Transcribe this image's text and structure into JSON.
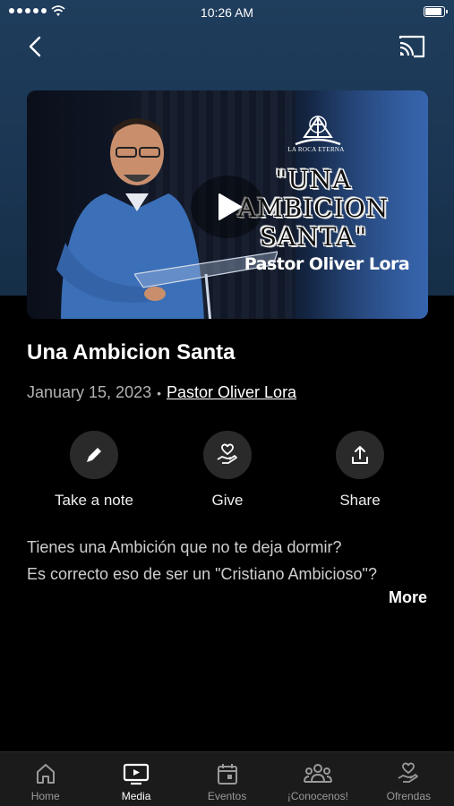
{
  "status_bar": {
    "time": "10:26 AM",
    "battery_level": 0.95
  },
  "nav": {
    "back_icon": "chevron-left-icon",
    "cast_icon": "cast-icon"
  },
  "video": {
    "logo_text": "LA ROCA ETERNA",
    "title_line1": "\"UNA AMBICION",
    "title_line2": "SANTA\"",
    "speaker_overlay": "Pastor Oliver Lora",
    "play_icon": "play-icon"
  },
  "sermon": {
    "title": "Una Ambicion Santa",
    "date": "January 15, 2023",
    "separator": "•",
    "speaker": "Pastor Oliver Lora"
  },
  "actions": [
    {
      "label": "Take a note",
      "icon": "pencil-icon"
    },
    {
      "label": "Give",
      "icon": "give-heart-hand-icon"
    },
    {
      "label": "Share",
      "icon": "share-upload-icon"
    }
  ],
  "description": {
    "line1": "Tienes una Ambición que no te deja dormir?",
    "line2": "Es correcto eso de ser un \"Cristiano Ambicioso\"?",
    "more_label": "More"
  },
  "tabbar": {
    "active": "Media",
    "tabs": [
      {
        "label": "Home",
        "icon": "home-icon"
      },
      {
        "label": "Media",
        "icon": "media-tv-icon"
      },
      {
        "label": "Eventos",
        "icon": "calendar-icon"
      },
      {
        "label": "¡Conocenos!",
        "icon": "group-people-icon"
      },
      {
        "label": "Ofrendas",
        "icon": "give-heart-hand-icon"
      }
    ]
  },
  "colors": {
    "background": "#000000",
    "header": "#1f3d5c",
    "tabbar": "#1b1b1b",
    "action_circle": "#2a2a2a"
  }
}
